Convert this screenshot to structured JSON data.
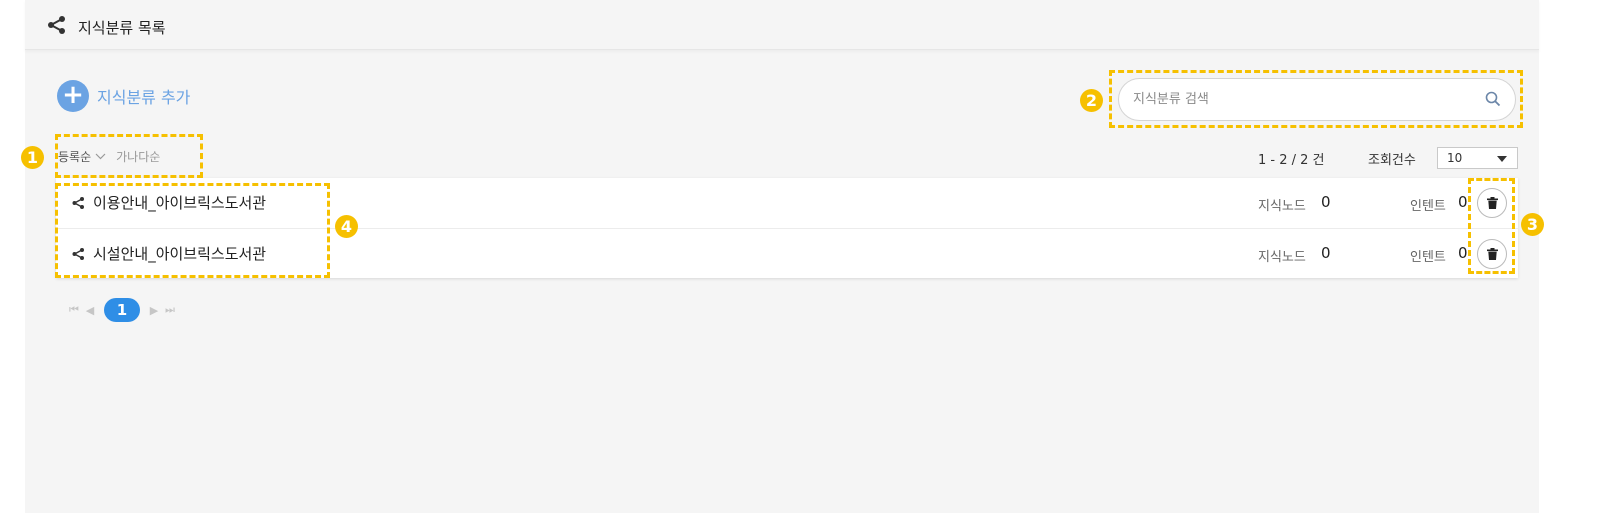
{
  "header": {
    "title": "지식분류 목록",
    "icon": "share-icon"
  },
  "toolbar": {
    "add_label": "지식분류 추가",
    "search_placeholder": "지식분류 검색"
  },
  "sort": {
    "options": [
      "등록순",
      "가나다순"
    ],
    "selected": "등록순"
  },
  "summary": {
    "count_text": "1 - 2 / 2 건",
    "rows_per_page_label": "조회건수",
    "rows_per_page": "10"
  },
  "list": {
    "node_label": "지식노드",
    "intent_label": "인텐트",
    "items": [
      {
        "name": "이용안내_아이브릭스도서관",
        "nodes": "0",
        "intents": "0"
      },
      {
        "name": "시설안내_아이브릭스도서관",
        "nodes": "0",
        "intents": "0"
      }
    ]
  },
  "pagination": {
    "current": "1"
  },
  "callouts": [
    "1",
    "2",
    "3",
    "4"
  ],
  "colors": {
    "accent": "#6ba3e3",
    "page_active": "#2f8ee6",
    "callout": "#f6c000",
    "panel_bg": "#f5f5f5"
  }
}
